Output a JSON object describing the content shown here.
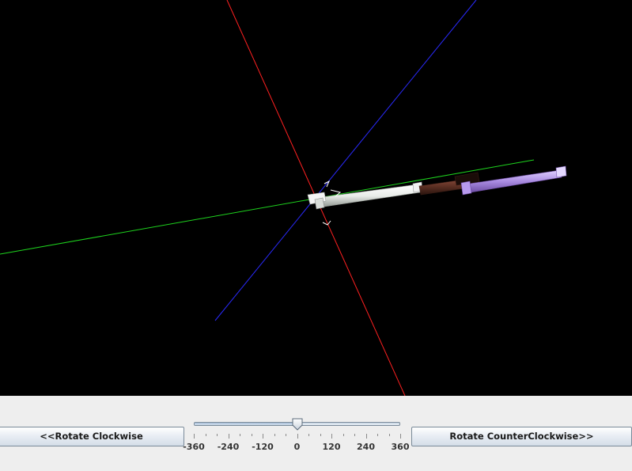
{
  "scene": {
    "background": "#000000",
    "axis_colors": {
      "x": "#ff2020",
      "y": "#1ed41e",
      "z": "#2a2aff"
    },
    "arm_segment_colors": [
      "#e8ece8",
      "#5a2e22",
      "#a88ae0"
    ]
  },
  "controls": {
    "rotate_clockwise_label": "<<Rotate Clockwise",
    "rotate_counterclockwise_label": "Rotate CounterClockwise>>",
    "slider": {
      "min": -360,
      "max": 360,
      "value": 0,
      "major_tick_spacing": 120,
      "minor_tick_spacing": 40,
      "tick_labels": [
        "-360",
        "-240",
        "-120",
        "0",
        "120",
        "240",
        "360"
      ]
    }
  }
}
